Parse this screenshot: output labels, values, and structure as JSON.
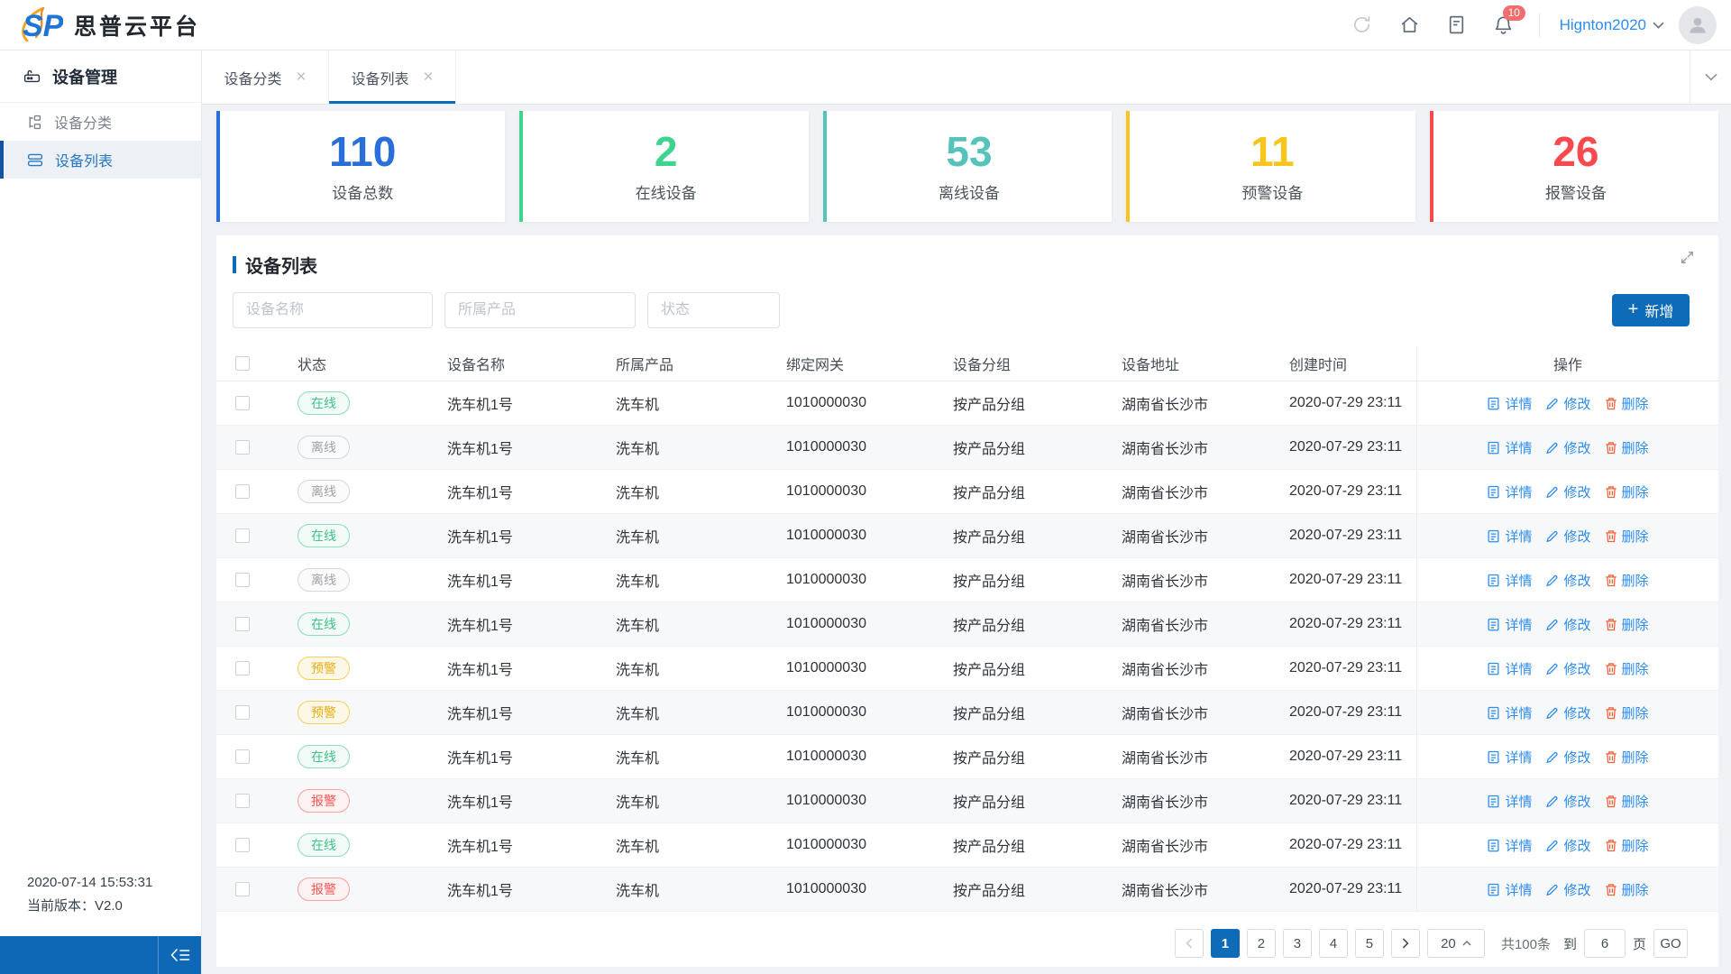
{
  "header": {
    "brand": "思普云平台",
    "notification_count": "10",
    "username": "Hignton2020"
  },
  "sidebar": {
    "section": "设备管理",
    "items": [
      {
        "label": "设备分类",
        "active": false
      },
      {
        "label": "设备列表",
        "active": true
      }
    ],
    "footer_time": "2020-07-14 15:53:31",
    "footer_version": "当前版本：V2.0"
  },
  "tabs": [
    {
      "label": "设备分类",
      "active": false
    },
    {
      "label": "设备列表",
      "active": true
    }
  ],
  "stats": [
    {
      "value": "110",
      "label": "设备总数",
      "color": "#2a6ed9"
    },
    {
      "value": "2",
      "label": "在线设备",
      "color": "#3ed48f"
    },
    {
      "value": "53",
      "label": "离线设备",
      "color": "#55c3b9"
    },
    {
      "value": "11",
      "label": "预警设备",
      "color": "#f9c51d"
    },
    {
      "value": "26",
      "label": "报警设备",
      "color": "#f8494e"
    }
  ],
  "panel": {
    "title": "设备列表",
    "filters": [
      {
        "placeholder": "设备名称"
      },
      {
        "placeholder": "所属产品"
      },
      {
        "placeholder": "状态"
      }
    ],
    "add_button": "新增"
  },
  "table": {
    "columns": [
      "状态",
      "设备名称",
      "所属产品",
      "绑定网关",
      "设备分组",
      "设备地址",
      "创建时间",
      "操作"
    ],
    "actions": {
      "detail": "详情",
      "edit": "修改",
      "delete": "删除"
    },
    "status_colors": {
      "online": {
        "text": "#41c188",
        "border": "#8edcb8",
        "bg": "#f2fbf7"
      },
      "offline": {
        "text": "#9da3a9",
        "border": "#d3d6da",
        "bg": "#fbfbfc"
      },
      "warning": {
        "text": "#e9ae14",
        "border": "#f3cf5e",
        "bg": "#fdf7e7"
      },
      "alarm": {
        "text": "#f25555",
        "border": "#f6a0a0",
        "bg": "#fdf1f1"
      }
    },
    "rows": [
      {
        "status": "在线",
        "status_type": "online",
        "name": "洗车机1号",
        "product": "洗车机",
        "gateway": "1010000030",
        "group": "按产品分组",
        "address": "湖南省长沙市",
        "created": "2020-07-29 23:11"
      },
      {
        "status": "离线",
        "status_type": "offline",
        "name": "洗车机1号",
        "product": "洗车机",
        "gateway": "1010000030",
        "group": "按产品分组",
        "address": "湖南省长沙市",
        "created": "2020-07-29 23:11"
      },
      {
        "status": "离线",
        "status_type": "offline",
        "name": "洗车机1号",
        "product": "洗车机",
        "gateway": "1010000030",
        "group": "按产品分组",
        "address": "湖南省长沙市",
        "created": "2020-07-29 23:11"
      },
      {
        "status": "在线",
        "status_type": "online",
        "name": "洗车机1号",
        "product": "洗车机",
        "gateway": "1010000030",
        "group": "按产品分组",
        "address": "湖南省长沙市",
        "created": "2020-07-29 23:11"
      },
      {
        "status": "离线",
        "status_type": "offline",
        "name": "洗车机1号",
        "product": "洗车机",
        "gateway": "1010000030",
        "group": "按产品分组",
        "address": "湖南省长沙市",
        "created": "2020-07-29 23:11"
      },
      {
        "status": "在线",
        "status_type": "online",
        "name": "洗车机1号",
        "product": "洗车机",
        "gateway": "1010000030",
        "group": "按产品分组",
        "address": "湖南省长沙市",
        "created": "2020-07-29 23:11"
      },
      {
        "status": "预警",
        "status_type": "warning",
        "name": "洗车机1号",
        "product": "洗车机",
        "gateway": "1010000030",
        "group": "按产品分组",
        "address": "湖南省长沙市",
        "created": "2020-07-29 23:11"
      },
      {
        "status": "预警",
        "status_type": "warning",
        "name": "洗车机1号",
        "product": "洗车机",
        "gateway": "1010000030",
        "group": "按产品分组",
        "address": "湖南省长沙市",
        "created": "2020-07-29 23:11"
      },
      {
        "status": "在线",
        "status_type": "online",
        "name": "洗车机1号",
        "product": "洗车机",
        "gateway": "1010000030",
        "group": "按产品分组",
        "address": "湖南省长沙市",
        "created": "2020-07-29 23:11"
      },
      {
        "status": "报警",
        "status_type": "alarm",
        "name": "洗车机1号",
        "product": "洗车机",
        "gateway": "1010000030",
        "group": "按产品分组",
        "address": "湖南省长沙市",
        "created": "2020-07-29 23:11"
      },
      {
        "status": "在线",
        "status_type": "online",
        "name": "洗车机1号",
        "product": "洗车机",
        "gateway": "1010000030",
        "group": "按产品分组",
        "address": "湖南省长沙市",
        "created": "2020-07-29 23:11"
      },
      {
        "status": "报警",
        "status_type": "alarm",
        "name": "洗车机1号",
        "product": "洗车机",
        "gateway": "1010000030",
        "group": "按产品分组",
        "address": "湖南省长沙市",
        "created": "2020-07-29 23:11"
      }
    ]
  },
  "pagination": {
    "prev": "‹",
    "pages": [
      "1",
      "2",
      "3",
      "4",
      "5"
    ],
    "active_page": "1",
    "next": "›",
    "page_size": "20",
    "total": "共100条",
    "jump_prefix": "到",
    "jump_value": "6",
    "jump_suffix": "页",
    "go": "GO"
  },
  "colors": {
    "primary": "#0e6bb8",
    "link": "#2d8cf0",
    "badge_red": "#f56c6c"
  }
}
